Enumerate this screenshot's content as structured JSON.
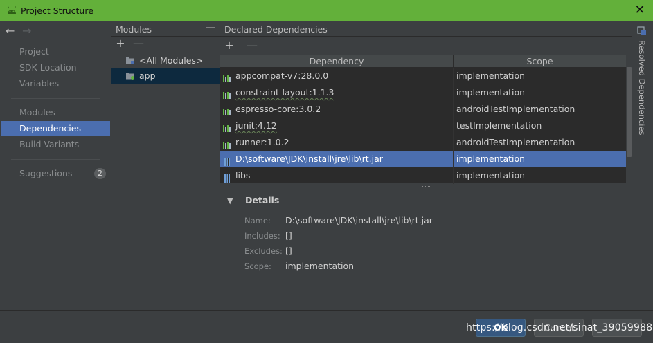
{
  "window": {
    "title": "Project Structure",
    "close_glyph": "✕"
  },
  "nav": {
    "back_glyph": "←",
    "forward_glyph": "→",
    "items_group1": [
      "Project",
      "SDK Location",
      "Variables"
    ],
    "items_group2": [
      "Modules",
      "Dependencies",
      "Build Variants"
    ],
    "suggestions": {
      "label": "Suggestions",
      "count": "2"
    },
    "selected": "Dependencies"
  },
  "modules_panel": {
    "title": "Modules",
    "minimize_glyph": "—",
    "add_glyph": "+",
    "remove_glyph": "—",
    "items": [
      {
        "label": "<All Modules>",
        "icon": "all-modules-icon",
        "selected": false
      },
      {
        "label": "app",
        "icon": "module-folder-icon",
        "selected": true
      }
    ]
  },
  "dependencies_panel": {
    "title": "Declared Dependencies",
    "add_glyph": "+",
    "remove_glyph": "—",
    "columns": [
      "Dependency",
      "Scope"
    ],
    "rows": [
      {
        "dependency": "appcompat-v7:28.0.0",
        "scope": "implementation",
        "icon": "library-icon",
        "squiggle": false,
        "selected": false
      },
      {
        "dependency": "constraint-layout:1.1.3",
        "scope": "implementation",
        "icon": "library-icon",
        "squiggle": true,
        "selected": false
      },
      {
        "dependency": "espresso-core:3.0.2",
        "scope": "androidTestImplementation",
        "icon": "library-icon",
        "squiggle": false,
        "selected": false
      },
      {
        "dependency": "junit:4.12",
        "scope": "testImplementation",
        "icon": "library-icon",
        "squiggle": true,
        "selected": false
      },
      {
        "dependency": "runner:1.0.2",
        "scope": "androidTestImplementation",
        "icon": "library-icon",
        "squiggle": false,
        "selected": false
      },
      {
        "dependency": "D:\\software\\JDK\\install\\jre\\lib\\rt.jar",
        "scope": "implementation",
        "icon": "jar-icon",
        "squiggle": false,
        "selected": true
      },
      {
        "dependency": "libs",
        "scope": "implementation",
        "icon": "jar-icon",
        "squiggle": false,
        "selected": false
      }
    ]
  },
  "details": {
    "title": "Details",
    "expander_glyph": "▼",
    "fields": [
      {
        "label": "Name:",
        "value": "D:\\software\\JDK\\install\\jre\\lib\\rt.jar"
      },
      {
        "label": "Includes:",
        "value": "[]"
      },
      {
        "label": "Excludes:",
        "value": "[]"
      },
      {
        "label": "Scope:",
        "value": "implementation"
      }
    ]
  },
  "right_strip": {
    "label": "Resolved Dependencies"
  },
  "footer": {
    "ok_label": "OK",
    "cancel_label": "Cancel",
    "watermark": "https://blog.csdn.net/sinat_39059988"
  },
  "colors": {
    "accent": "#4b6eaf",
    "titlebar": "#63b03a",
    "background": "#3c3f41",
    "table_bg": "#2b2b2b"
  }
}
